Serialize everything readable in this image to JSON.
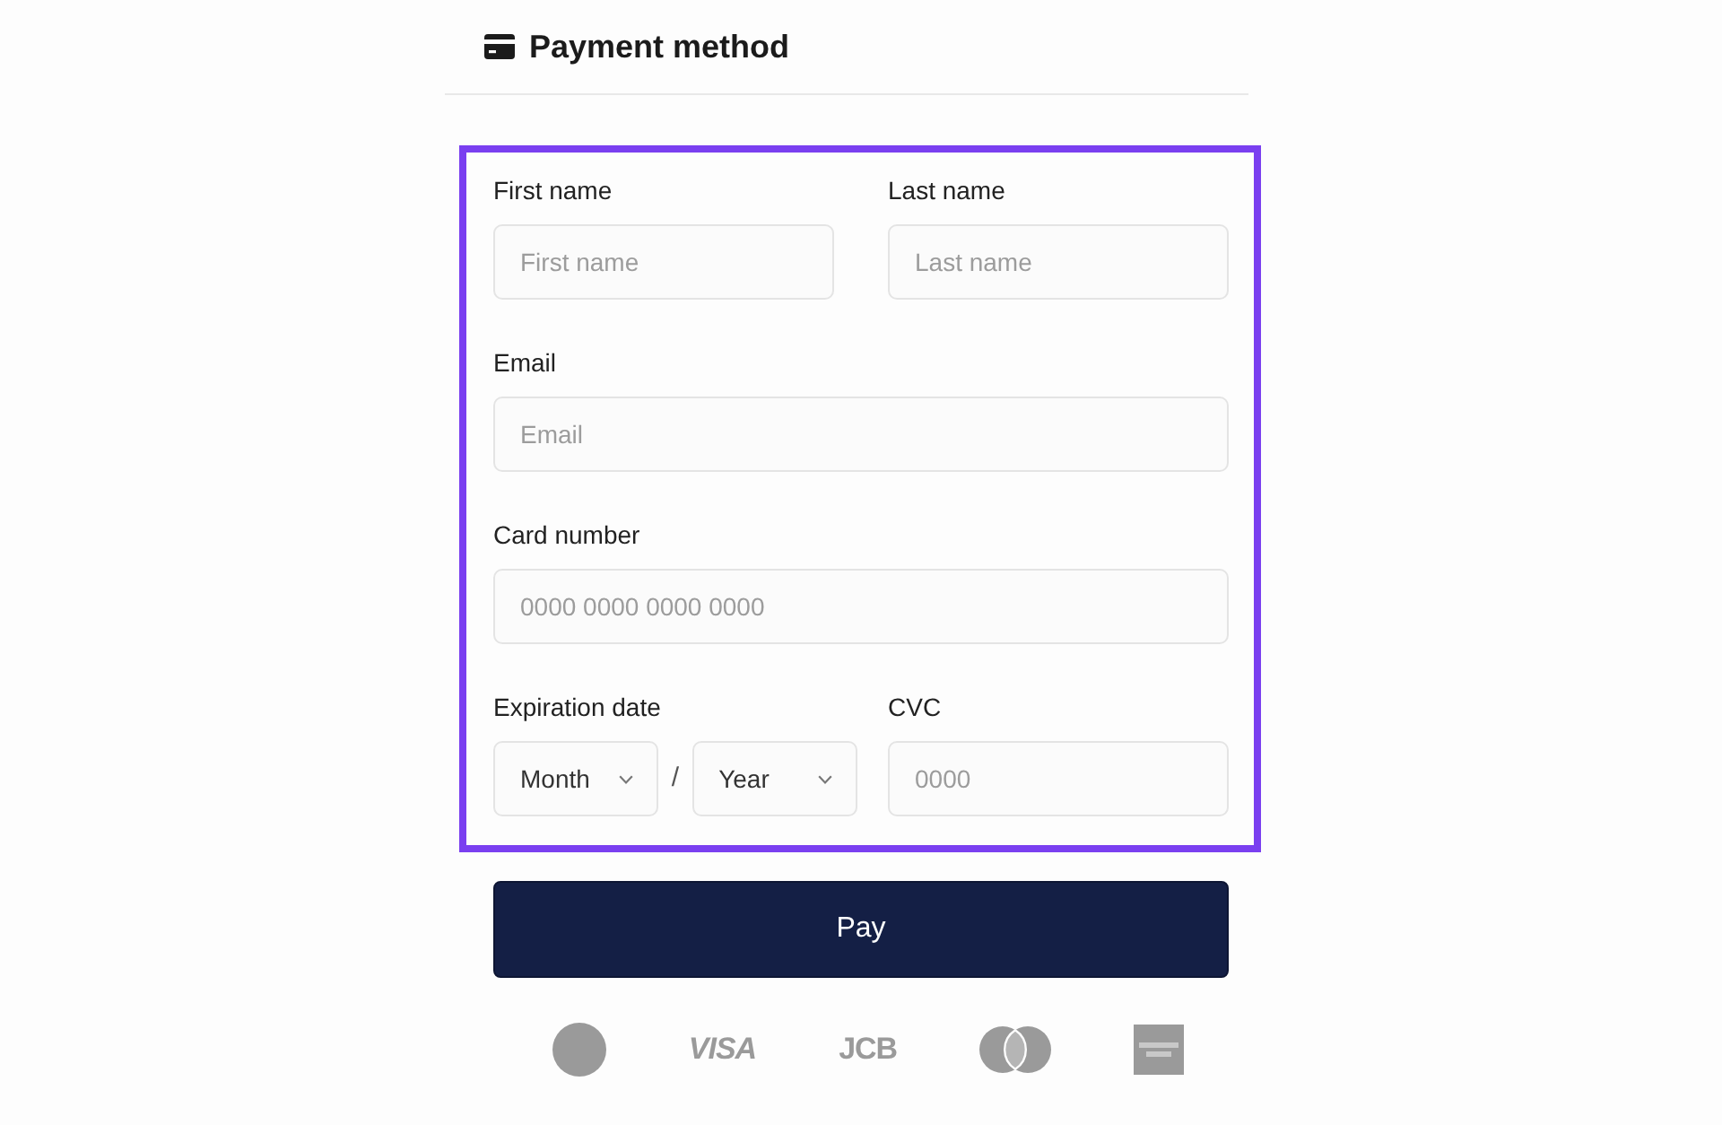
{
  "header": {
    "title": "Payment method"
  },
  "form": {
    "highlighted": true,
    "rows": [
      {
        "fields": [
          {
            "kind": "input",
            "label": "First name",
            "placeholder": "First name"
          },
          {
            "kind": "input",
            "label": "Last name",
            "placeholder": "Last name"
          }
        ]
      },
      {
        "fields": [
          {
            "kind": "input",
            "label": "Email",
            "placeholder": "Email"
          }
        ]
      },
      {
        "fields": [
          {
            "kind": "input",
            "label": "Card number",
            "placeholder": "0000 0000 0000 0000"
          }
        ]
      },
      {
        "fields": [
          {
            "kind": "date",
            "label": "Expiration date",
            "month": "Month",
            "separator": "/",
            "year": "Year"
          },
          {
            "kind": "input",
            "label": "CVC",
            "placeholder": "0000"
          }
        ]
      }
    ]
  },
  "pay_button": {
    "label": "Pay"
  },
  "card_logos": [
    {
      "kind": "circle"
    },
    {
      "kind": "wordmark",
      "text": "VISA",
      "italic": true
    },
    {
      "kind": "wordmark",
      "text": "JCB",
      "italic": false
    },
    {
      "kind": "rings"
    },
    {
      "kind": "tile"
    }
  ]
}
